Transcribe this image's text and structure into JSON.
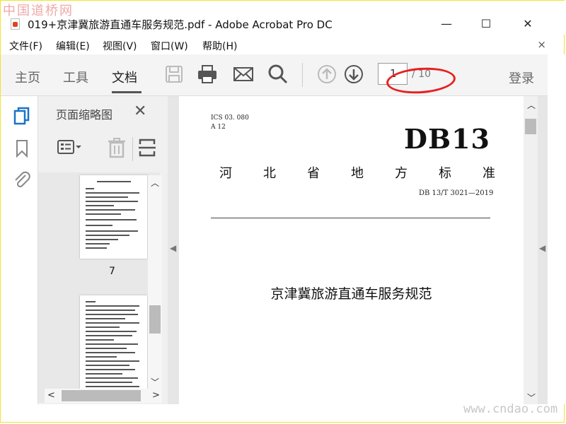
{
  "watermark_top": "中国道桥网",
  "watermark_bottom": "www.cndao.com",
  "window": {
    "title": "019+京津冀旅游直通车服务规范.pdf - Adobe Acrobat Pro DC",
    "minimize": "—",
    "maximize": "☐",
    "close": "✕"
  },
  "menu": {
    "items": [
      "文件(F)",
      "编辑(E)",
      "视图(V)",
      "窗口(W)",
      "帮助(H)"
    ],
    "close": "×"
  },
  "toolbar": {
    "tabs": [
      "主页",
      "工具",
      "文档"
    ],
    "active_tab": "文档",
    "icons": [
      "save-icon",
      "print-icon",
      "mail-icon",
      "search-icon",
      "previous-page-icon",
      "next-page-icon"
    ],
    "current_page": "1",
    "total_pages": "/ 10",
    "login": "登录"
  },
  "left_strip": {
    "icons": [
      "page-thumbnails-icon",
      "bookmark-icon",
      "attachment-icon"
    ]
  },
  "thumbnails_pane": {
    "title": "页面缩略图",
    "close": "✕",
    "tools": [
      "thumbnail-options-icon",
      "delete-icon",
      "rotate-page-icon"
    ],
    "pages": [
      {
        "label": "7"
      },
      {
        "label": ""
      }
    ]
  },
  "document": {
    "ics_line": "ICS   03. 080",
    "class_line": "A  12",
    "standard_code": "DB13",
    "issuer_chars": [
      "河",
      "北",
      "省",
      "地",
      "方",
      "标",
      "准"
    ],
    "standard_number": "DB 13/T  3021—2019",
    "standard_name": "京津冀旅游直通车服务规范"
  },
  "colors": {
    "accent": "#1a73c8",
    "annotation_ellipse": "#e82020",
    "toolbar_bg": "#f4f4f4"
  }
}
